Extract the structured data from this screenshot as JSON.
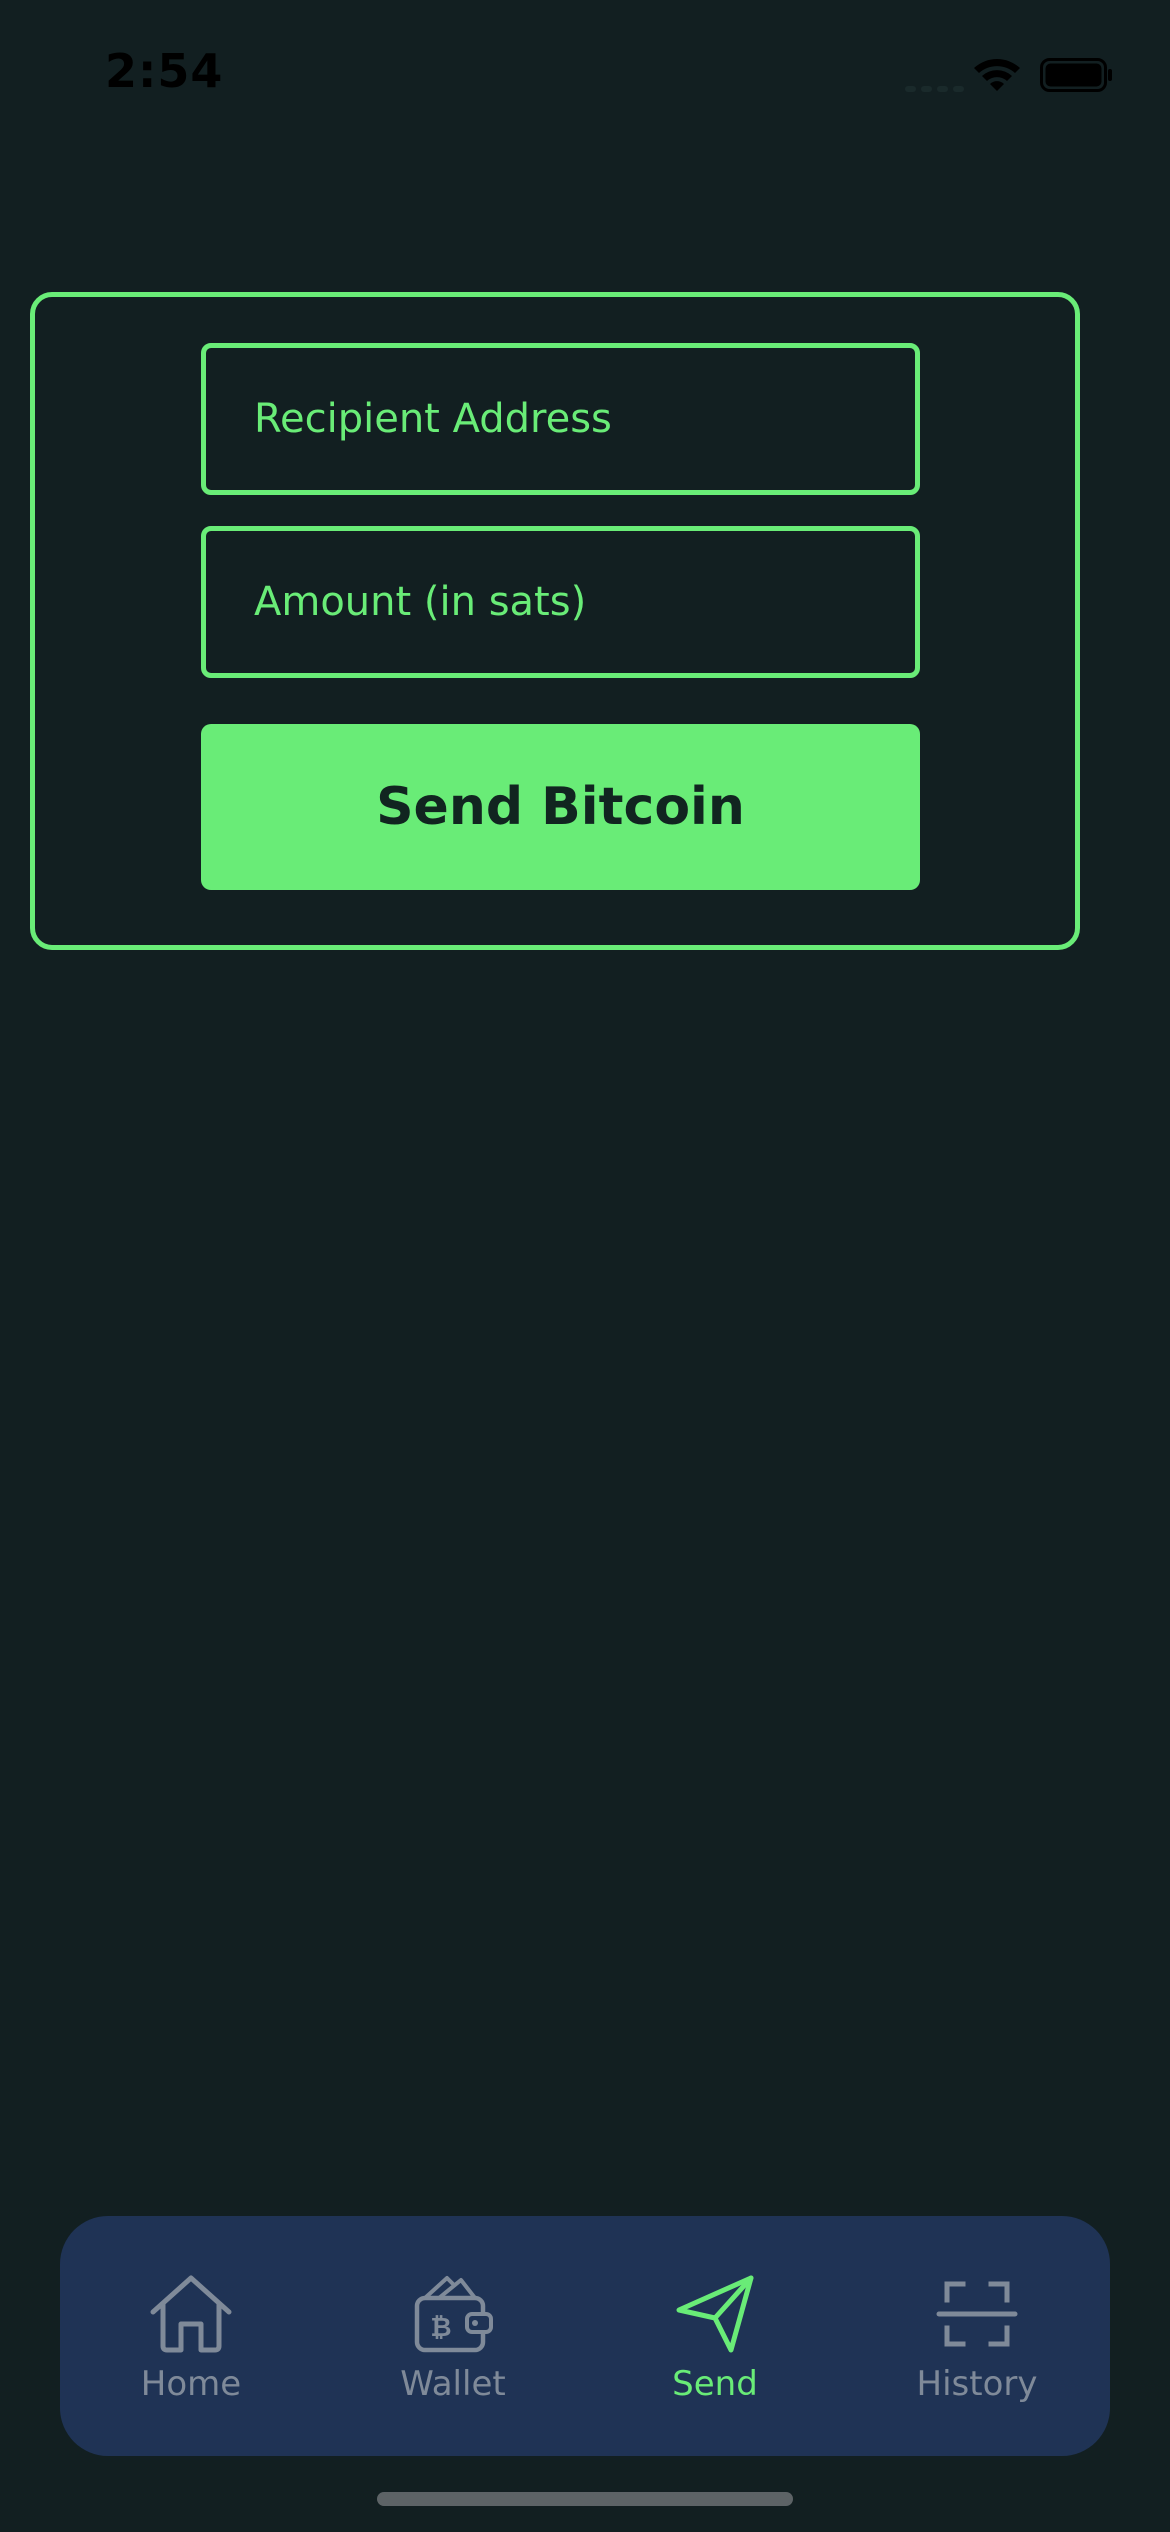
{
  "status_bar": {
    "time": "2:54"
  },
  "send_form": {
    "recipient_placeholder": "Recipient Address",
    "amount_placeholder": "Amount (in sats)",
    "send_button_label": "Send Bitcoin"
  },
  "tab_bar": {
    "tabs": [
      {
        "label": "Home",
        "icon": "home-icon",
        "active": false
      },
      {
        "label": "Wallet",
        "icon": "wallet-icon",
        "active": false
      },
      {
        "label": "Send",
        "icon": "send-icon",
        "active": true
      },
      {
        "label": "History",
        "icon": "scan-icon",
        "active": false
      }
    ]
  },
  "colors": {
    "background": "#121f21",
    "accent": "#69ec77",
    "tab_bar": "#1f3355",
    "inactive_tab": "#7f8a99"
  }
}
